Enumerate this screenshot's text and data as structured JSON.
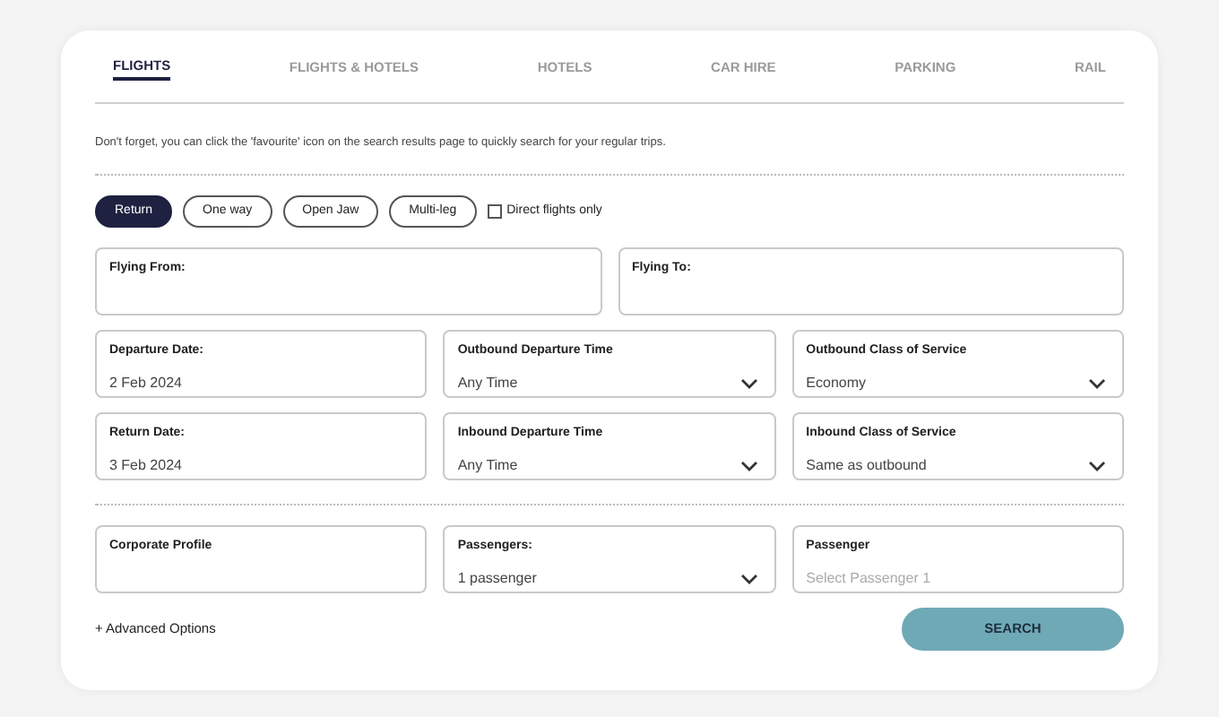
{
  "tabs": [
    {
      "label": "FLIGHTS",
      "selected": true
    },
    {
      "label": "FLIGHTS & HOTELS",
      "selected": false
    },
    {
      "label": "HOTELS",
      "selected": false
    },
    {
      "label": "CAR HIRE",
      "selected": false
    },
    {
      "label": "PARKING",
      "selected": false
    },
    {
      "label": "RAIL",
      "selected": false
    }
  ],
  "notice": "Don't forget, you can click the 'favourite' icon on the search results page to quickly search for your regular trips.",
  "trip_types": [
    {
      "label": "Return",
      "selected": true
    },
    {
      "label": "One way",
      "selected": false
    },
    {
      "label": "Open Jaw",
      "selected": false
    },
    {
      "label": "Multi-leg",
      "selected": false
    }
  ],
  "direct_flights": {
    "label": "Direct flights only",
    "checked": false
  },
  "route_fields": [
    {
      "kind": "text",
      "label": "Flying From:"
    },
    {
      "kind": "text",
      "label": "Flying To:"
    }
  ],
  "date_rows": [
    [
      {
        "kind": "text",
        "label": "Departure Date:",
        "value": "2 Feb 2024"
      },
      {
        "kind": "select",
        "label": "Outbound Departure Time",
        "value": "Any Time"
      },
      {
        "kind": "select",
        "label": "Outbound Class of Service",
        "value": "Economy"
      }
    ],
    [
      {
        "kind": "text",
        "label": "Return Date:",
        "value": "3 Feb 2024"
      },
      {
        "kind": "select",
        "label": "Inbound Departure Time",
        "value": "Any Time"
      },
      {
        "kind": "select",
        "label": "Inbound Class of Service",
        "value": "Same as outbound"
      }
    ]
  ],
  "passenger_fields": [
    {
      "kind": "text",
      "label": "Corporate Profile"
    },
    {
      "kind": "select",
      "label": "Passengers:",
      "value": "1 passenger"
    },
    {
      "kind": "text",
      "label": "Passenger",
      "placeholder": "Select Passenger 1"
    }
  ],
  "advanced_options": "+ Advanced Options",
  "search_button": "SEARCH"
}
